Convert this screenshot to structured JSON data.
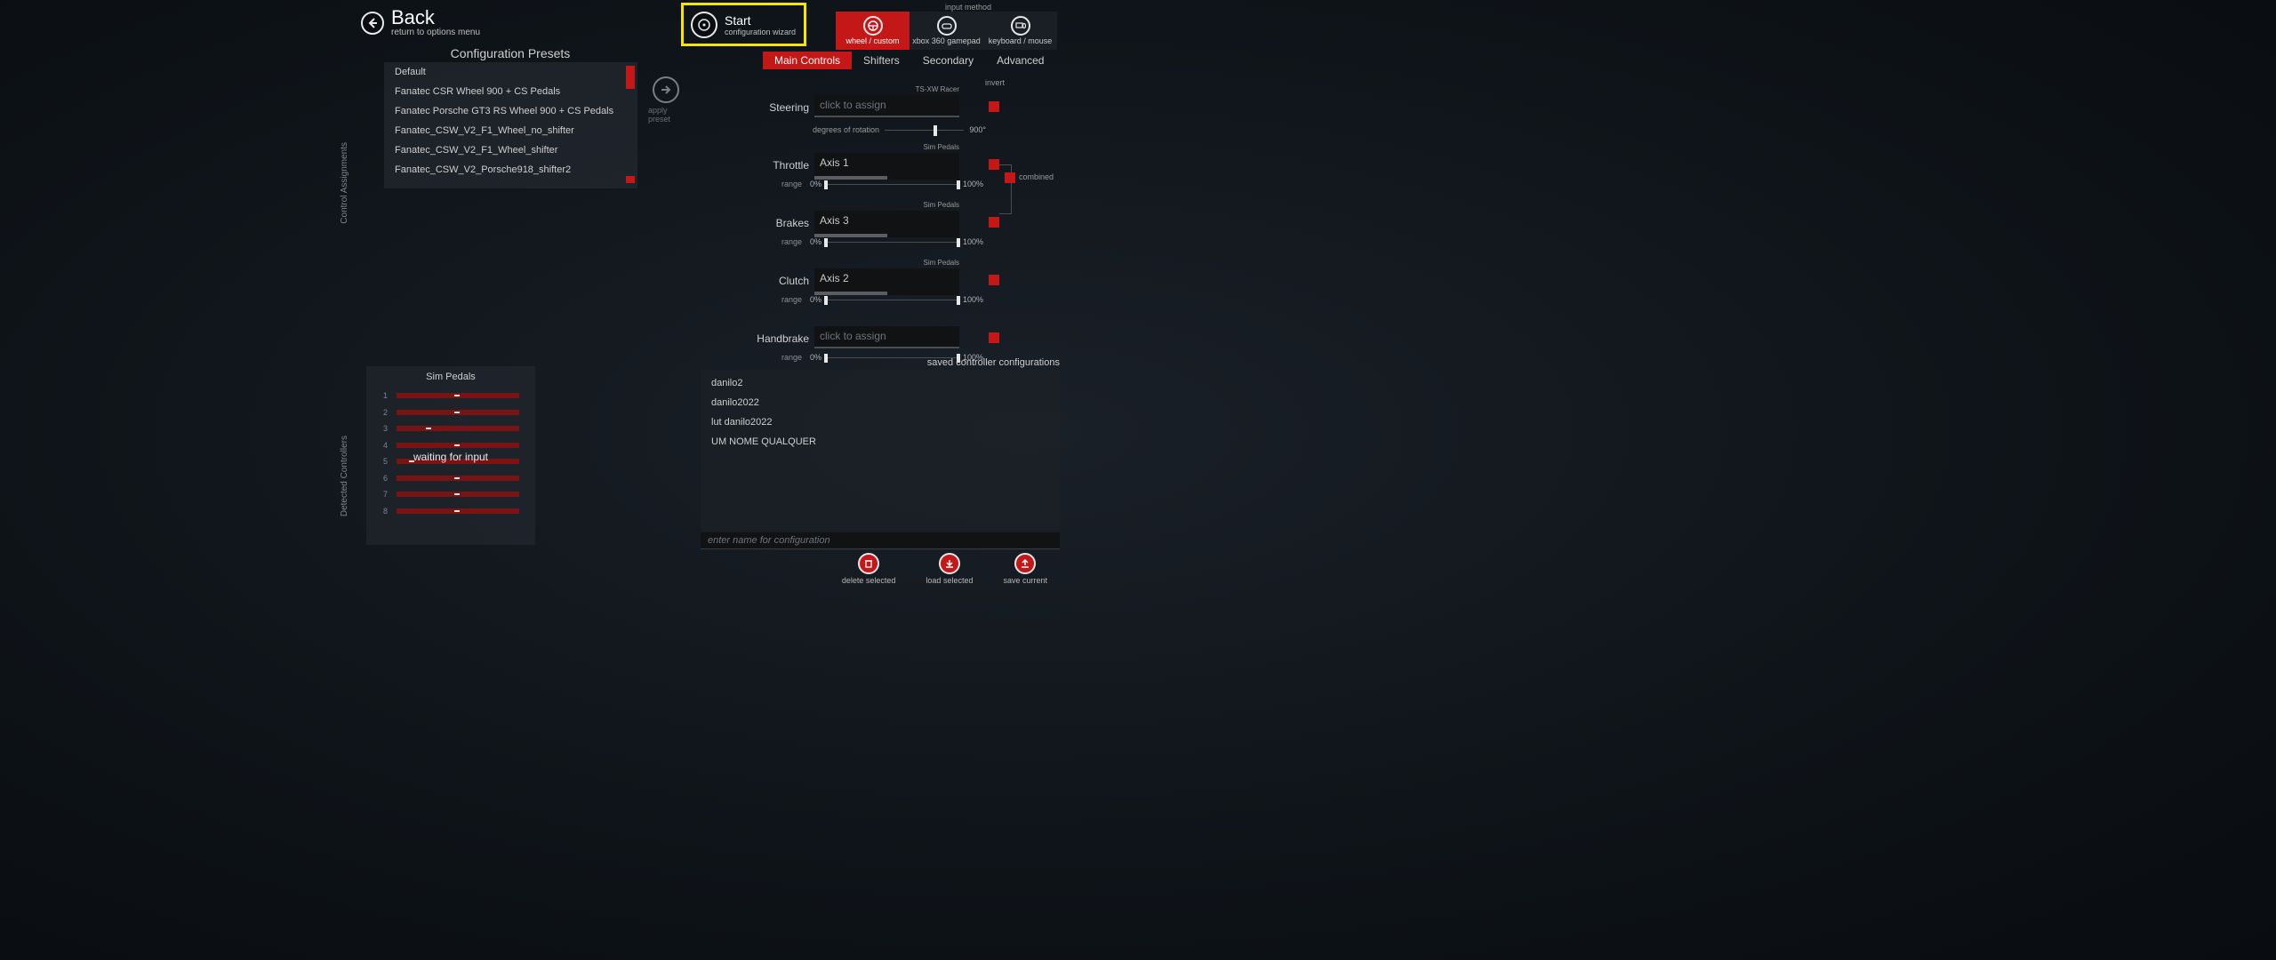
{
  "back": {
    "title": "Back",
    "subtitle": "return to options menu"
  },
  "start": {
    "title": "Start",
    "subtitle": "configuration wizard"
  },
  "input_method": {
    "label": "input method",
    "options": [
      {
        "label": "wheel / custom",
        "icon": "wheel",
        "active": true
      },
      {
        "label": "xbox 360 gamepad",
        "icon": "gamepad",
        "active": false
      },
      {
        "label": "keyboard / mouse",
        "icon": "kbm",
        "active": false
      }
    ]
  },
  "presets": {
    "title": "Configuration Presets",
    "items": [
      "Default",
      "Fanatec CSR Wheel 900 + CS Pedals",
      "Fanatec Porsche GT3 RS Wheel 900 + CS Pedals",
      "Fanatec_CSW_V2_F1_Wheel_no_shifter",
      "Fanatec_CSW_V2_F1_Wheel_shifter",
      "Fanatec_CSW_V2_Porsche918_shifter2"
    ],
    "apply_label": "apply preset"
  },
  "side_labels": {
    "assignments": "Control Assignments",
    "detected": "Detected Controllers"
  },
  "tabs": [
    "Main Controls",
    "Shifters",
    "Secondary",
    "Advanced"
  ],
  "active_tab": 0,
  "invert_label": "invert",
  "combined_label": "combined",
  "controls": {
    "steering": {
      "name": "Steering",
      "device": "TS-XW Racer",
      "assignment": "",
      "placeholder": "click to assign",
      "deg_label": "degrees of rotation",
      "deg_value": "900°"
    },
    "throttle": {
      "name": "Throttle",
      "device": "Sim Pedals",
      "assignment": "Axis 1",
      "progress": 50,
      "range_label": "range",
      "range_min": "0%",
      "range_max": "100%"
    },
    "brakes": {
      "name": "Brakes",
      "device": "Sim Pedals",
      "assignment": "Axis 3",
      "progress": 50,
      "range_label": "range",
      "range_min": "0%",
      "range_max": "100%"
    },
    "clutch": {
      "name": "Clutch",
      "device": "Sim Pedals",
      "assignment": "Axis 2",
      "progress": 50,
      "range_label": "range",
      "range_min": "0%",
      "range_max": "100%"
    },
    "handbrake": {
      "name": "Handbrake",
      "device": "",
      "assignment": "",
      "placeholder": "click to assign",
      "range_label": "range",
      "range_min": "0%",
      "range_max": "100%"
    }
  },
  "detected": {
    "title": "Sim Pedals",
    "waiting": "waiting for input"
  },
  "saved": {
    "title": "saved controller configurations",
    "items": [
      "danilo2",
      "danilo2022",
      "lut danilo2022",
      "UM NOME QUALQUER"
    ],
    "input_placeholder": "enter name for configuration",
    "buttons": {
      "delete": "delete selected",
      "load": "load selected",
      "save": "save current"
    }
  }
}
